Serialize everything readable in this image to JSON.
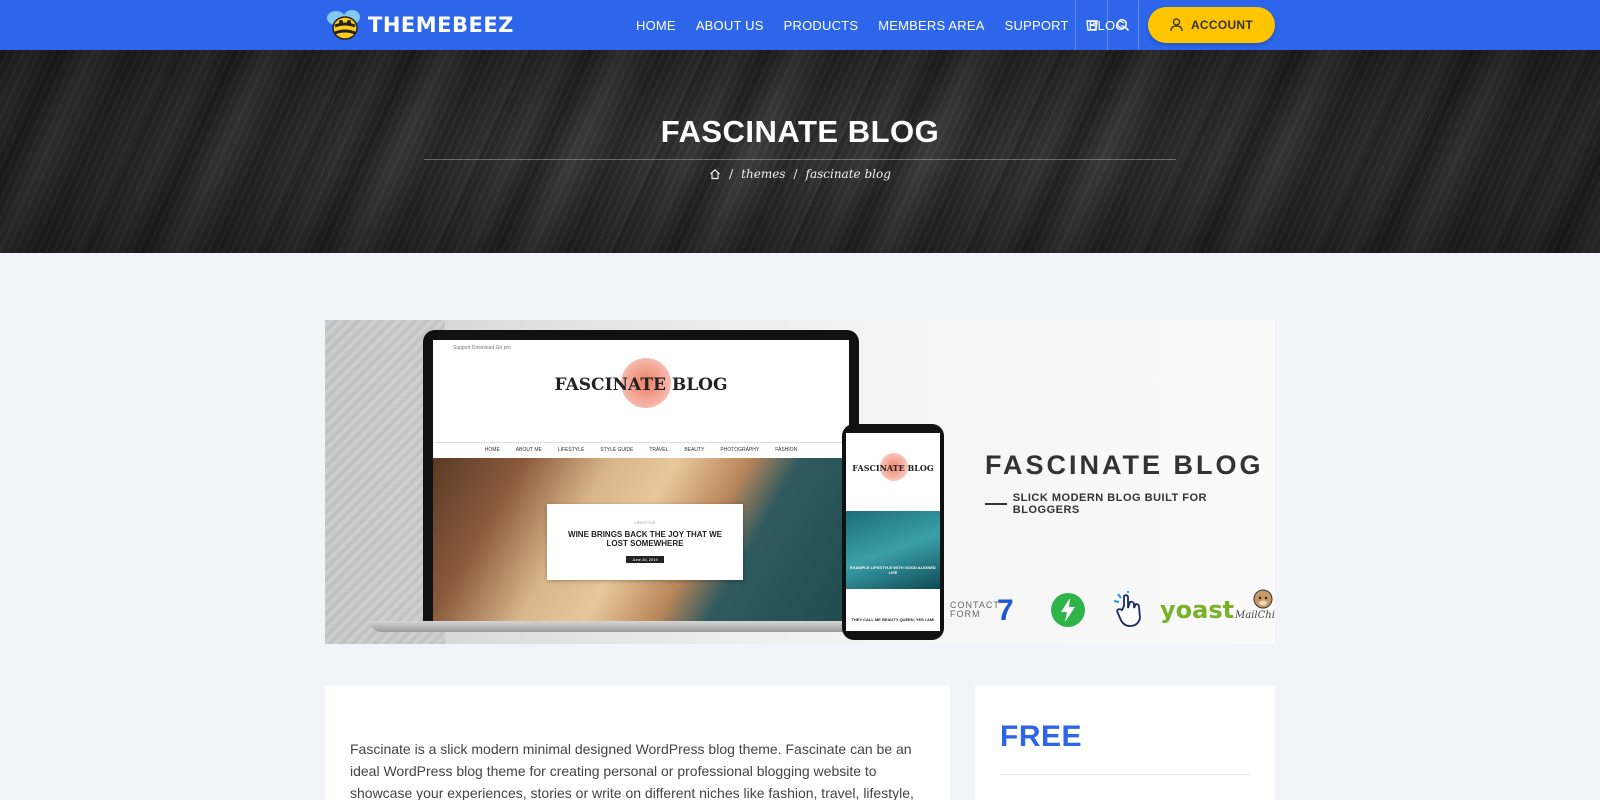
{
  "header": {
    "brand": "THEMEBEEZ",
    "nav": [
      "HOME",
      "ABOUT US",
      "PRODUCTS",
      "MEMBERS AREA",
      "SUPPORT",
      "BLOG"
    ],
    "account_label": "ACCOUNT",
    "accent_color": "#2d66eb",
    "account_color": "#ffc400",
    "icons": [
      "cart-icon",
      "search-icon",
      "user-icon"
    ]
  },
  "hero": {
    "title": "FASCINATE BLOG",
    "breadcrumb": [
      "themes",
      "fascinate blog"
    ],
    "breadcrumb_separator": "/"
  },
  "banner": {
    "laptop": {
      "top_links": "Support  Download  Go pro",
      "logo": "FASCINATE BLOG",
      "menu": [
        "HOME",
        "ABOUT ME",
        "LIFESTYLE",
        "STYLE GUIDE",
        "TRAVEL",
        "BEAUTY",
        "PHOTOGRAPHY",
        "FASHION"
      ],
      "post_category": "LIFESTYLE",
      "post_title": "WINE BRINGS BACK THE JOY THAT WE LOST SOMEWHERE",
      "post_date": "June 26, 2019"
    },
    "phone": {
      "logo": "FASCINATE BLOG",
      "post_title": "EXAMPLE LIFESTYLE WITH GOOD ALIGNED LIFE",
      "post_title_2": "THEY CALL ME BEAUTY QUEEN, YES I AM!"
    },
    "title": "FASCINATE BLOG",
    "subtitle": "SLICK MODERN BLOG BUILT FOR BLOGGERS",
    "plugins": {
      "contact_form": "CONTACT FORM",
      "contact_form_number": "7",
      "yoast": "yoast",
      "mailchimp": "MailChimp"
    }
  },
  "content": {
    "description": "Fascinate is a slick modern minimal designed WordPress blog theme. Fascinate can be an ideal WordPress blog theme for creating personal or professional blogging website to showcase your experiences, stories or write on different niches like fashion, travel, lifestyle,"
  },
  "sidebar": {
    "price_label": "FREE"
  }
}
